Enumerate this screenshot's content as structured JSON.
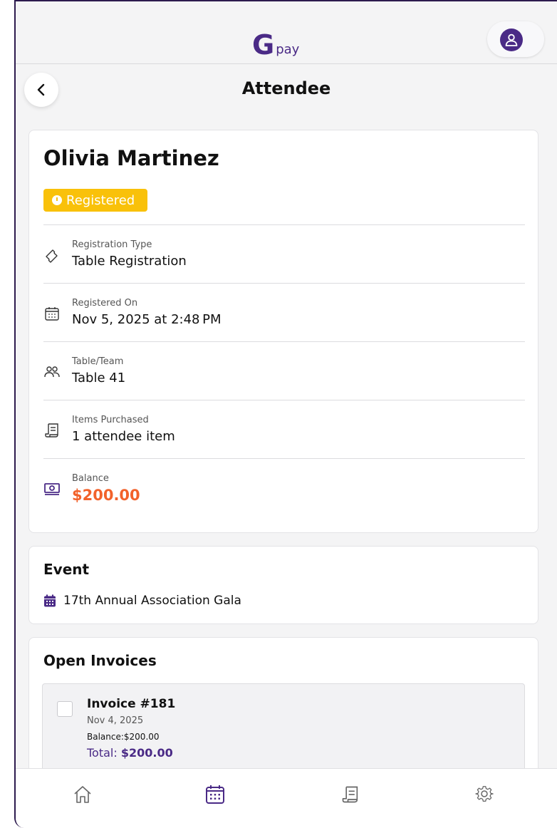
{
  "app": {
    "logo_letter": "G",
    "logo_word": "pay"
  },
  "header": {
    "title": "Attendee"
  },
  "attendee": {
    "name": "Olivia Martinez",
    "status": "Registered",
    "fields": [
      {
        "label": "Registration Type",
        "value": "Table Registration",
        "icon": "ticket-icon"
      },
      {
        "label": "Registered On",
        "value": "Nov 5, 2025 at 2:48 PM",
        "icon": "calendar-icon"
      },
      {
        "label": "Table/Team",
        "value": "Table 41",
        "icon": "people-icon"
      },
      {
        "label": "Items Purchased",
        "value": "1 attendee item",
        "icon": "receipt-icon"
      },
      {
        "label": "Balance",
        "value": "$200.00",
        "icon": "money-icon"
      }
    ]
  },
  "event": {
    "section_title": "Event",
    "name": "17th Annual Association Gala",
    "icon": "calendar-filled-icon"
  },
  "invoices": {
    "section_title": "Open Invoices",
    "items": [
      {
        "title": "Invoice #181",
        "date": "Nov 4, 2025",
        "balance_label": "Balance:",
        "balance": "$200.00",
        "total_label": "Total:",
        "total": "$200.00",
        "checked": false
      }
    ]
  },
  "nav": [
    {
      "name": "home",
      "icon": "home-icon",
      "active": false
    },
    {
      "name": "events",
      "icon": "calendar-icon",
      "active": true
    },
    {
      "name": "invoices",
      "icon": "receipt-icon",
      "active": false
    },
    {
      "name": "settings",
      "icon": "gear-icon",
      "active": false
    }
  ],
  "colors": {
    "brand": "#4a2a86",
    "badge": "#f9c10a",
    "balance": "#f2622b"
  }
}
